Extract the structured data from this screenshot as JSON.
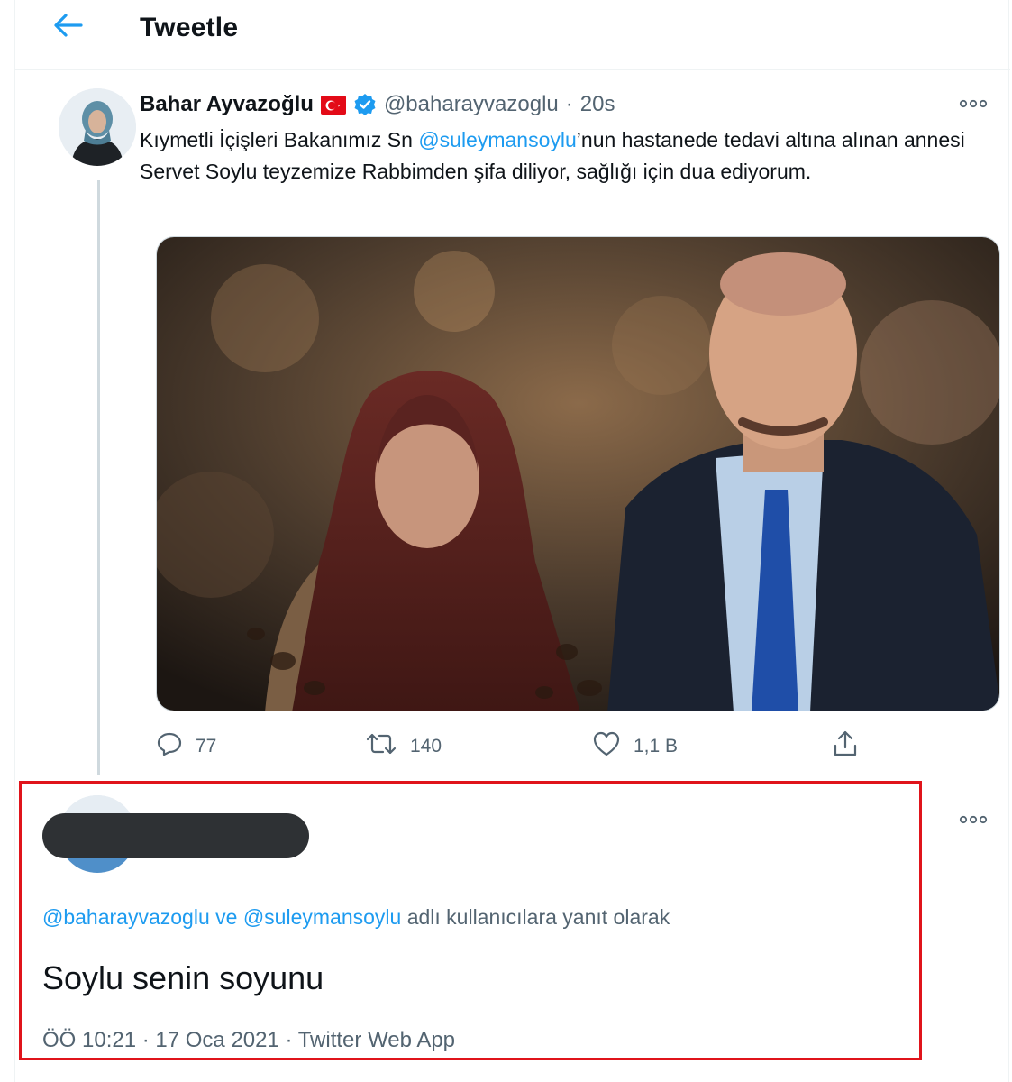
{
  "header": {
    "title": "Tweetle",
    "back_icon": "arrow-left-icon"
  },
  "tweet": {
    "display_name": "Bahar Ayvazoğlu",
    "handle": "@baharayvazoglu",
    "separator": "·",
    "time": "20s",
    "text_before_mention": "Kıymetli İçişleri Bakanımız Sn ",
    "mention": "@suleymansoylu",
    "text_after_mention": "’nun hastanede tedavi altına alınan annesi Servet Soylu teyzemize Rabbimden şifa diliyor, sağlığı için dua ediyorum.",
    "stats": {
      "replies": "77",
      "retweets": "140",
      "likes": "1,1 B"
    }
  },
  "reply": {
    "reply_to_mention_1": "@baharayvazoglu",
    "reply_to_conj": " ve ",
    "reply_to_mention_2": "@suleymansoylu",
    "reply_to_suffix": " adlı kullanıcılara yanıt olarak",
    "text": "Soylu senin soyunu",
    "meta": "ÖÖ 10:21 · 17 Oca 2021 · Twitter Web App"
  },
  "colors": {
    "accent": "#1d9bf0",
    "highlight_border": "#e0141b",
    "muted": "#536471"
  }
}
